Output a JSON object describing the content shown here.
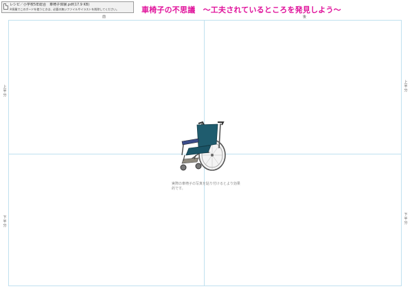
{
  "header": {
    "file_info": "レシピ／小学校5年総合　車椅子体験.pdf(17.9 KB)",
    "note": "※授業でこのボードを使うときは、必要の無いファイルやイラストを削除してください。",
    "title": "車椅子の不思議　～工夫されているところを発見しよう～"
  },
  "board": {
    "front_label": "前",
    "back_label": "後",
    "upper_half": "上半分",
    "lower_half": "下半分"
  },
  "hint": "実際の車椅子の写真を貼り付けるとより効果的です。",
  "colors": {
    "title": "#e0129b",
    "grid": "#bfe0ef",
    "seat": "#1f5c6e"
  }
}
